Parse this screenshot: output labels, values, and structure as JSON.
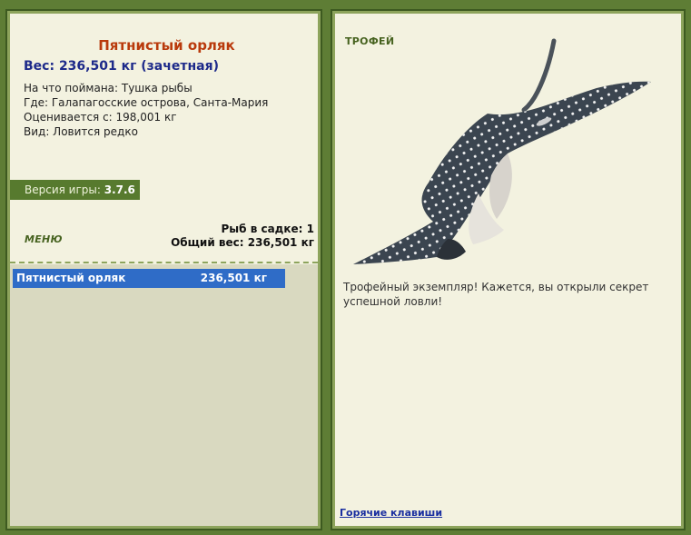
{
  "fish": {
    "name": "Пятнистый орляк",
    "weight_line": "Вес: 236,501 кг (зачетная)",
    "bait": "На что поймана: Тушка рыбы",
    "location": "Где: Галапагосские острова, Санта-Мария",
    "rated_from": "Оценивается с: 198,001 кг",
    "rarity": "Вид: Ловится редко"
  },
  "version": {
    "label": "Версия игры:",
    "value": "3.7.6"
  },
  "menu": {
    "label": "МЕНЮ"
  },
  "totals": {
    "fish_count": "Рыб в садке: 1",
    "total_weight": "Общий вес: 236,501 кг"
  },
  "fish_list": [
    {
      "name": "Пятнистый орляк",
      "weight": "236,501 кг"
    }
  ],
  "trophy": {
    "heading": "ТРОФЕЙ",
    "image_icon": "spotted-eagle-ray",
    "message": "Трофейный экземпляр! Кажется, вы открыли секрет успешной ловли!",
    "hotkeys": "Горячие клавиши"
  },
  "colors": {
    "background": "#5e7d35",
    "panel": "#f3f2e0",
    "title": "#b93a0c",
    "weight": "#1d2a8a",
    "selected_row": "#2f6cc7",
    "accent": "#577a2e"
  }
}
